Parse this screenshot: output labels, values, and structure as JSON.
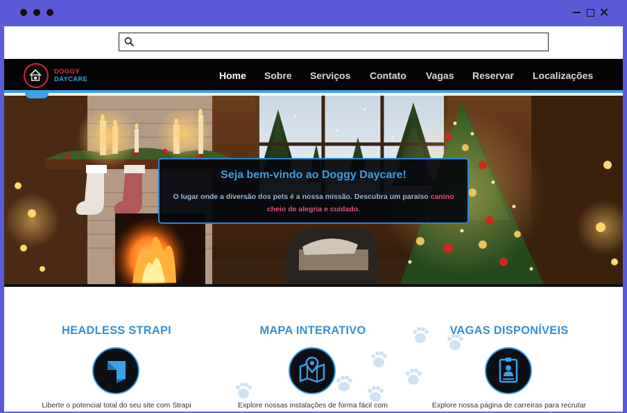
{
  "browser": {
    "window_controls": [
      "minimize-icon",
      "maximize-icon",
      "close-icon"
    ],
    "address_bar": {
      "value": "",
      "icon": "search-icon"
    }
  },
  "site": {
    "logo": {
      "line1": "DOGGY",
      "line2": "DAYCARE"
    },
    "nav": [
      {
        "label": "Home",
        "active": true
      },
      {
        "label": "Sobre"
      },
      {
        "label": "Serviços"
      },
      {
        "label": "Contato"
      },
      {
        "label": "Vagas"
      },
      {
        "label": "Reservar"
      },
      {
        "label": "Localizações"
      }
    ]
  },
  "hero": {
    "title": "Seja bem-vindo ao Doggy Daycare!",
    "text_part1": "O lugar onde a diversão dos pets é a nossa missão. Descubra um paraíso",
    "text_part2": "canino cheio de alegria e cuidado."
  },
  "features": [
    {
      "title": "HEADLESS STRAPI",
      "icon": "strapi-logo-icon",
      "desc": "Liberte o potencial total do seu site com Strapi"
    },
    {
      "title": "MAPA INTERATIVO",
      "icon": "map-pin-icon",
      "desc": "Explore nossas instalações de forma fácil com"
    },
    {
      "title": "VAGAS DISPONÍVEIS",
      "icon": "job-badge-icon",
      "desc": "Explore nossa página de carreiras para recrutar"
    }
  ],
  "colors": {
    "accent_blue": "#3aa0e8",
    "brand_red": "#e33040",
    "highlight_pink": "#e0507a",
    "header_bg": "#050505",
    "window_frame": "#5b5bd8"
  }
}
